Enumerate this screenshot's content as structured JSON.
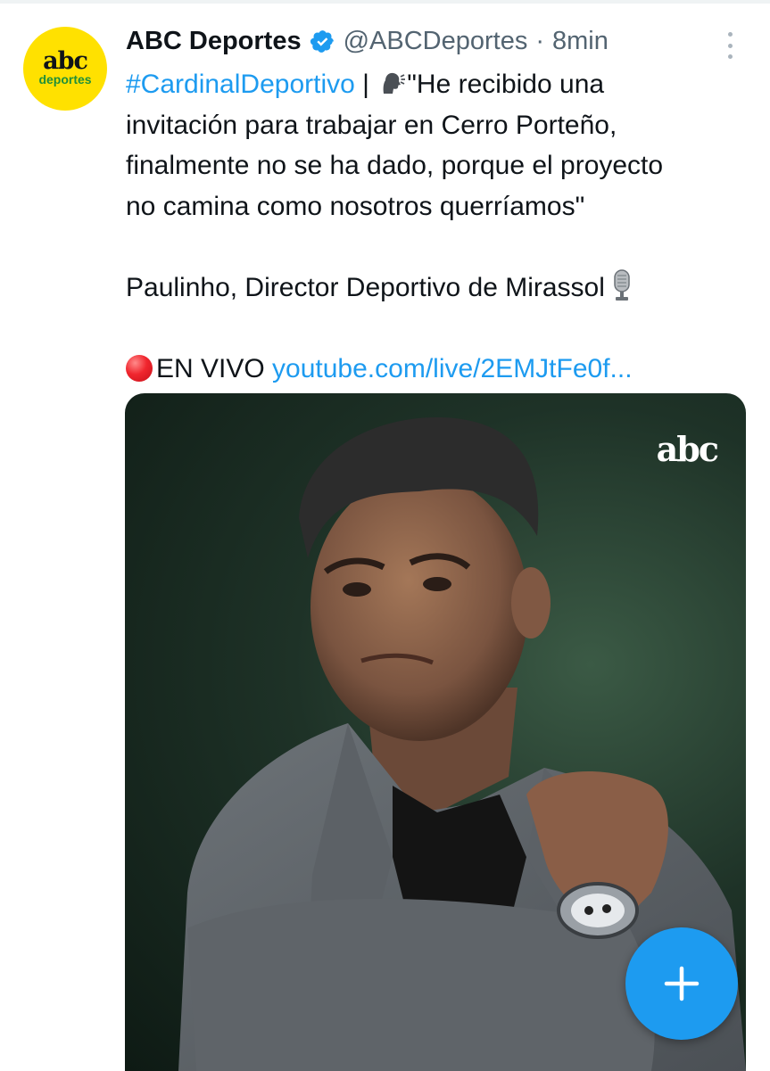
{
  "tweet": {
    "author": {
      "name": "ABC Deportes",
      "handle": "@ABCDeportes",
      "avatar_logo_main": "abc",
      "avatar_logo_sub": "deportes",
      "verified_icon": "verified-badge-icon"
    },
    "separator": "·",
    "time": "8min",
    "text": {
      "hashtag": "#CardinalDeportivo",
      "pipe": " | ",
      "line1_rest": "\"He recibido una",
      "line2": "invitación para trabajar en Cerro Porteño,",
      "line3": "finalmente no se ha dado, porque el proyecto",
      "line4": "no camina como nosotros querríamos\"",
      "attribution": "Paulinho, Director Deportivo de Mirassol",
      "live_label": "EN VIVO",
      "live_link": "youtube.com/live/2EMJtFe0f..."
    },
    "media": {
      "watermark": "abc",
      "description_icon": "photo"
    }
  },
  "compose_button": {
    "icon": "plus-icon"
  },
  "colors": {
    "link": "#1d9bf0",
    "secondary_text": "#536471",
    "avatar_bg": "#ffe100",
    "fab_bg": "#1d9bf0"
  }
}
